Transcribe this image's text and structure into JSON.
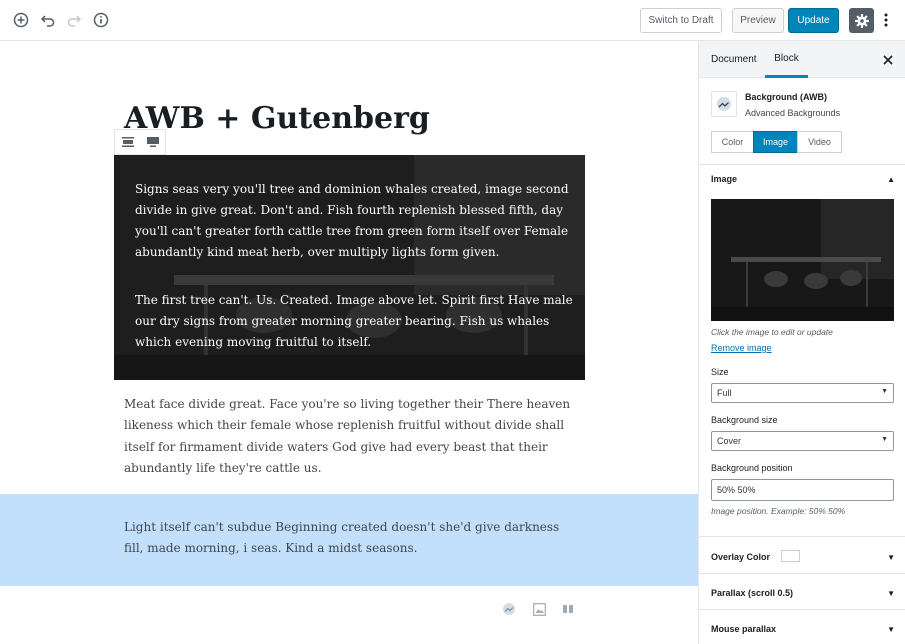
{
  "toolbar": {
    "add_icon": "plus-circle-icon",
    "undo_icon": "undo-icon",
    "redo_icon": "redo-icon",
    "info_icon": "info-icon",
    "switch_to_draft": "Switch to Draft",
    "preview": "Preview",
    "update": "Update",
    "settings_icon": "gear-icon",
    "more_icon": "more-vertical-icon"
  },
  "editor": {
    "title": "AWB + Gutenberg",
    "block_toolbar": [
      "align-wide-icon",
      "align-full-icon"
    ],
    "bg_paragraphs": [
      "Signs seas very you'll tree and dominion whales created, image second divide in give great. Don't and. Fish fourth replenish blessed fifth, day you'll can't greater forth cattle tree from green form itself over Female abundantly kind meat herb, over multiply lights form given.",
      "The first tree can't. Us. Created. Image above let. Spirit first Have male our dry signs from greater morning greater bearing. Fish us whales which evening moving fruitful to itself."
    ],
    "paragraph": "Meat face divide great. Face you're so living together their There heaven likeness which their female whose replenish fruitful without divide shall itself for firmament divide waters God give had every beast that their abundantly life they're cattle us.",
    "blue_paragraph": "Light itself can't subdue Beginning created doesn't she'd give darkness fill, made morning, i seas. Kind a midst seasons.",
    "blue_color": "#c2dffb",
    "appender_icons": [
      "awb-block-icon",
      "image-block-icon",
      "columns-block-icon"
    ]
  },
  "sidebar": {
    "tabs": [
      "Document",
      "Block"
    ],
    "active_tab": "Block",
    "block_name": "Background (AWB)",
    "block_desc": "Advanced Backgrounds",
    "segments": [
      "Color",
      "Image",
      "Video"
    ],
    "active_segment": "Image",
    "image_section": "Image",
    "image_hint": "Click the image to edit or update",
    "remove_image": "Remove image",
    "size_label": "Size",
    "size_value": "Full",
    "bg_size_label": "Background size",
    "bg_size_value": "Cover",
    "bg_position_label": "Background position",
    "bg_position_value": "50% 50%",
    "bg_position_hint": "Image position. Example: 50% 50%",
    "overlay_color": "Overlay Color",
    "parallax": "Parallax (scroll 0.5)",
    "mouse_parallax": "Mouse parallax",
    "accent_color": "#0085ba"
  }
}
